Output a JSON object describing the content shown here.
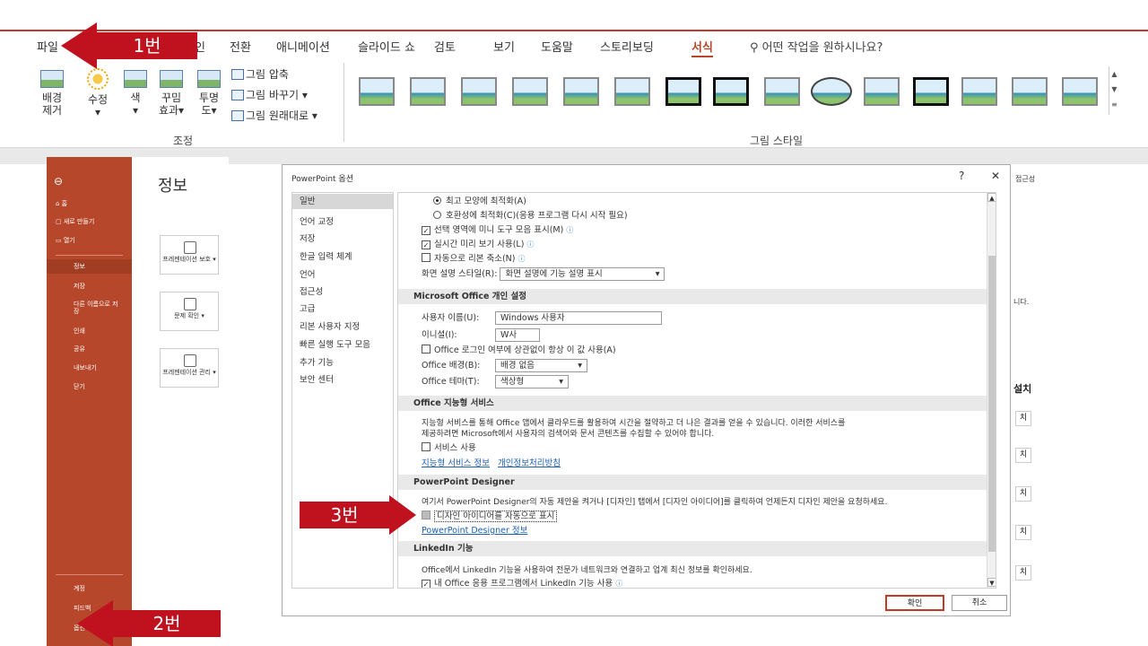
{
  "ribbon": {
    "tabs": [
      "파일",
      "인",
      "전환",
      "애니메이션",
      "슬라이드 쇼",
      "검토",
      "보기",
      "도움말",
      "스토리보딩",
      "서식"
    ],
    "search_text": "어떤 작업을 원하시나요?",
    "adjust": {
      "remove_bg_1": "배경",
      "remove_bg_2": "제거",
      "corrections": "수정",
      "color": "색",
      "artistic_1": "꾸밈",
      "artistic_2": "효과",
      "transparency_1": "투명",
      "transparency_2": "도",
      "compress": "그림 압축",
      "change": "그림 바꾸기",
      "reset": "그림 원래대로",
      "group_label": "조정"
    },
    "styles_group_label": "그림 스타일"
  },
  "backstage": {
    "top_items": [
      "홈",
      "새로 만들기",
      "열기"
    ],
    "items": [
      "정보",
      "저장",
      "다른 이름으로 저장",
      "인쇄",
      "공유",
      "내보내기",
      "닫기"
    ],
    "bottom_items": [
      "계정",
      "피드백",
      "옵션"
    ],
    "title": "정보",
    "cards": [
      "프레젠테이션 보호",
      "문제 확인",
      "프레젠테이션 관리"
    ]
  },
  "dialog": {
    "title": "PowerPoint 옵션",
    "help": "?",
    "close": "✕",
    "nav": [
      "일반",
      "언어 교정",
      "저장",
      "한글 입력 체계",
      "언어",
      "접근성",
      "고급",
      "리본 사용자 지정",
      "빠른 실행 도구 모음",
      "추가 기능",
      "보안 센터"
    ],
    "ui": {
      "opt_best": "최고 모양에 최적화(A)",
      "opt_compat": "호환성에 최적화(C)(응용 프로그램 다시 시작 필요)",
      "mini_toolbar": "선택 영역에 미니 도구 모음 표시(M)",
      "live_preview": "실시간 미리 보기 사용(L)",
      "collapse_ribbon": "자동으로 리본 축소(N)",
      "tooltip_label": "화면 설명 스타일(R):",
      "tooltip_value": "화면 설명에 기능 설명 표시"
    },
    "personal": {
      "header": "Microsoft Office 개인 설정",
      "username_label": "사용자 이름(U):",
      "username_value": "Windows 사용자",
      "initials_label": "이니셜(I):",
      "initials_value": "W사",
      "always_use": "Office 로그인 여부에 상관없이 항상 이 값 사용(A)",
      "bg_label": "Office 배경(B):",
      "bg_value": "배경 없음",
      "theme_label": "Office 테마(T):",
      "theme_value": "색상형"
    },
    "intelligent": {
      "header": "Office 지능형 서비스",
      "desc1": "지능형 서비스를 통해 Office 앱에서 클라우드를 활용하여 시간을 절약하고 더 나은 결과를 얻을 수 있습니다. 이러한 서비스를",
      "desc2": "제공하려면 Microsoft에서 사용자의 검색어와 문서 콘텐츠를 수집할 수 있어야 합니다.",
      "enable": "서비스 사용",
      "link1": "지능형 서비스 정보",
      "link2": "개인정보처리방침"
    },
    "designer": {
      "header": "PowerPoint Designer",
      "desc": "여기서 PowerPoint Designer의 자동 제안을 켜거나 [디자인] 탭에서 [디자인 아이디어]를 클릭하여 언제든지 디자인 제안을 요청하세요.",
      "auto_show": "디자인 아이디어를 자동으로 표시",
      "link": "PowerPoint Designer 정보"
    },
    "linkedin": {
      "header": "LinkedIn 기능",
      "desc": "Office에서 LinkedIn 기능을 사용하여 전문가 네트워크와 연결하고 업계 최신 정보를 확인하세요.",
      "enable": "내 Office 응용 프로그램에서 LinkedIn 기능 사용"
    },
    "ok": "확인",
    "cancel": "취소"
  },
  "right_panel": {
    "tab": "접근성",
    "text": "니다.",
    "heading": "설치",
    "buttons": [
      "치",
      "치",
      "치",
      "치",
      "치"
    ]
  },
  "annotations": {
    "step1": "1번",
    "step2": "2번",
    "step3": "3번"
  },
  "colors": {
    "accent": "#b7472a",
    "annotation": "#c0111f"
  }
}
